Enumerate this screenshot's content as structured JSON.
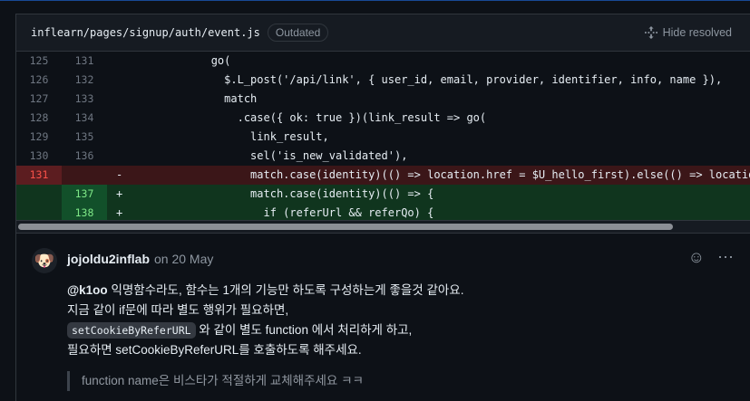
{
  "file": {
    "path": "inflearn/pages/signup/auth/event.js",
    "badge": "Outdated",
    "hide_resolved": "Hide resolved"
  },
  "diff": [
    {
      "type": "ctx",
      "old": "125",
      "new": "131",
      "sign": "",
      "code": "            go("
    },
    {
      "type": "ctx",
      "old": "126",
      "new": "132",
      "sign": "",
      "code": "              $.L_post('/api/link', { user_id, email, provider, identifier, info, name }),"
    },
    {
      "type": "ctx",
      "old": "127",
      "new": "133",
      "sign": "",
      "code": "              match"
    },
    {
      "type": "ctx",
      "old": "128",
      "new": "134",
      "sign": "",
      "code": "                .case({ ok: true })(link_result => go("
    },
    {
      "type": "ctx",
      "old": "129",
      "new": "135",
      "sign": "",
      "code": "                  link_result,"
    },
    {
      "type": "ctx",
      "old": "130",
      "new": "136",
      "sign": "",
      "code": "                  sel('is_new_validated'),"
    },
    {
      "type": "del",
      "old": "131",
      "new": "",
      "sign": "-",
      "code": "                  match.case(identity)(() => location.href = $U_hello_first).else(() => location.h"
    },
    {
      "type": "add",
      "old": "",
      "new": "137",
      "sign": "+",
      "code": "                  match.case(identity)(() => {"
    },
    {
      "type": "add",
      "old": "",
      "new": "138",
      "sign": "+",
      "code": "                    if (referUrl && referQo) {"
    }
  ],
  "comment": {
    "author": "jojoldu2inflab",
    "date": "on 20 May",
    "mention": "@k1oo",
    "line1_rest": " 익명함수라도, 함수는 1개의 기능만 하도록 구성하는게 좋을것 같아요.",
    "line2": "지금 같이 if문에 따라 별도 행위가 필요하면,",
    "line3_code": "setCookieByReferURL",
    "line3_rest": " 와 같이 별도 function 에서 처리하게 하고,",
    "line4": "필요하면 setCookieByReferURL를 호출하도록 해주세요.",
    "quote": "function name은 비스타가 적절하게 교체해주세요 ㅋㅋ"
  },
  "icons": {
    "avatar": "dog-avatar-icon",
    "emoji": "smiley-icon",
    "more": "kebab-icon",
    "expand": "unfold-icon"
  },
  "colors": {
    "deleted_bg": "#3b1618",
    "added_bg": "#10351e",
    "accent": "#1f6feb"
  }
}
